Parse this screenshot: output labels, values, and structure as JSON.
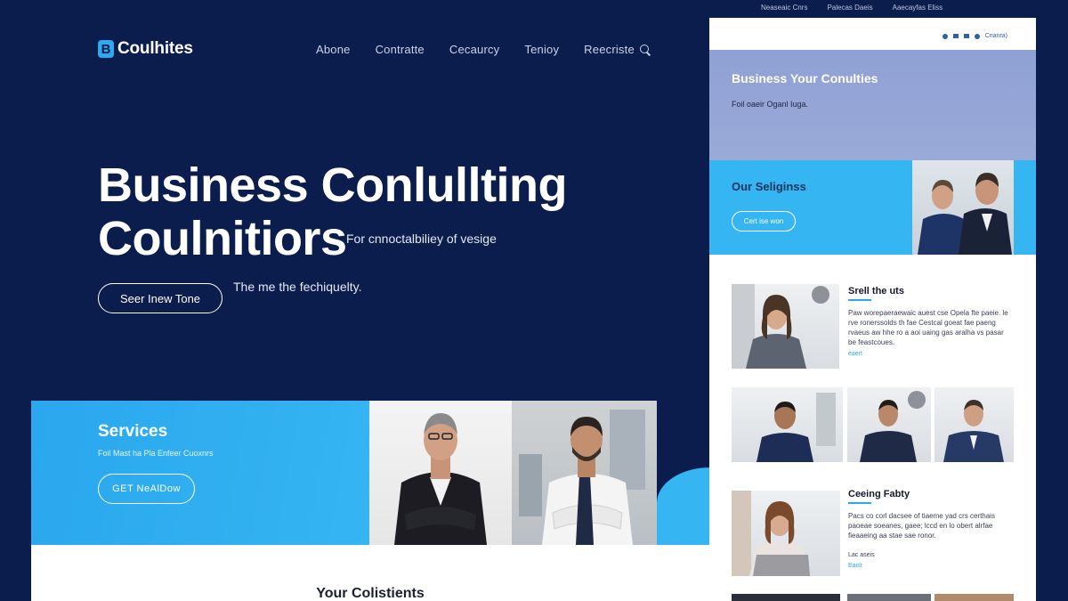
{
  "brand": {
    "mark": "B",
    "name": "Coulhites"
  },
  "nav": {
    "items": [
      "Abone",
      "Contratte",
      "Cecaurcy",
      "Tenioy",
      "Reecriste"
    ]
  },
  "hero": {
    "title_line1": "Business Conlullting",
    "title_line2": "Coulnitiors",
    "subtitle": "For cnnoctalbiliey of vesige",
    "tagline": "The me the fechiquelty.",
    "button": "Seer Inew Tone"
  },
  "services": {
    "title": "Services",
    "desc": "Foil Mast ha Pla Enfeer Cuoxnrs",
    "button": "GET NeAlDow"
  },
  "clients": {
    "title": "Your Colistients"
  },
  "top_links": [
    "Neaseaic Cnrs",
    "Palecas Daeis",
    "Aaecayfas Eliss"
  ],
  "mock": {
    "header_text": "Cnanra)",
    "hero_title": "Business Your Conulties",
    "hero_sub": "Foil oaeir Oganl Iuga.",
    "services_title": "Our Seliginss",
    "services_button": "Cert ise won",
    "section1_title": "Srell the uts",
    "section1_text": "Paw worepaeraewaic auest cse Opela fte paeie. le rve ronerssolds th fae Cestcal goeat fae paeng rvaeus aw hhe ro a aoi uaing gas aralha vs pasar be feastcoues.",
    "section1_link": "eaert",
    "section2_title": "Ceeing Fabty",
    "section2_text": "Pacs co corl dacsee of tiaeme yad crs certhais paoeae soeanes, gaee; lccd en lo obert alrfae fieaaeing aa stae sae ronor.",
    "section2_link_a": "Lac aseis",
    "section2_link_b": "Eaist"
  },
  "colors": {
    "background": "#0b1d4d",
    "accent": "#35b5f2",
    "mock_hero": "#8fa0d4",
    "white": "#ffffff"
  },
  "icons": [
    "search-icon",
    "phone-icon",
    "mail-icon",
    "user-icon"
  ]
}
